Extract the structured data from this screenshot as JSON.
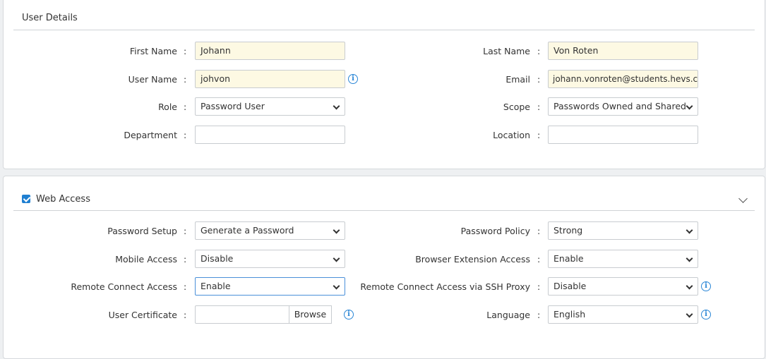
{
  "user_details": {
    "title": "User Details",
    "first_name": {
      "label": "First Name",
      "value": "Johann"
    },
    "last_name": {
      "label": "Last Name",
      "value": "Von Roten"
    },
    "user_name": {
      "label": "User Name",
      "value": "johvon"
    },
    "email": {
      "label": "Email",
      "value": "johann.vonroten@students.hevs.ch"
    },
    "role": {
      "label": "Role",
      "value": "Password User"
    },
    "scope": {
      "label": "Scope",
      "value": "Passwords Owned and Shared"
    },
    "department": {
      "label": "Department",
      "value": ""
    },
    "location": {
      "label": "Location",
      "value": ""
    }
  },
  "web_access": {
    "title": "Web Access",
    "checked": true,
    "password_setup": {
      "label": "Password Setup",
      "value": "Generate a Password"
    },
    "password_policy": {
      "label": "Password Policy",
      "value": "Strong"
    },
    "mobile_access": {
      "label": "Mobile Access",
      "value": "Disable"
    },
    "browser_extension": {
      "label": "Browser Extension Access",
      "value": "Enable"
    },
    "remote_connect": {
      "label": "Remote Connect Access",
      "value": "Enable"
    },
    "remote_ssh": {
      "label": "Remote Connect Access via SSH Proxy",
      "value": "Disable"
    },
    "user_certificate": {
      "label": "User Certificate",
      "value": "",
      "browse_label": "Browse"
    },
    "language": {
      "label": "Language",
      "value": "English"
    }
  },
  "colon": ":",
  "info_glyph": "i"
}
